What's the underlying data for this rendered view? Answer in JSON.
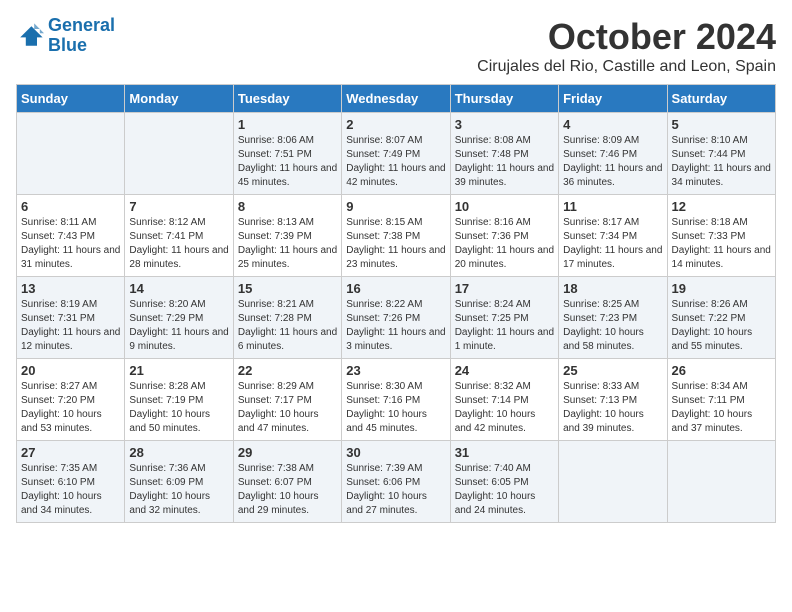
{
  "logo": {
    "line1": "General",
    "line2": "Blue"
  },
  "title": "October 2024",
  "location": "Cirujales del Rio, Castille and Leon, Spain",
  "weekdays": [
    "Sunday",
    "Monday",
    "Tuesday",
    "Wednesday",
    "Thursday",
    "Friday",
    "Saturday"
  ],
  "weeks": [
    [
      {
        "day": "",
        "sunrise": "",
        "sunset": "",
        "daylight": ""
      },
      {
        "day": "",
        "sunrise": "",
        "sunset": "",
        "daylight": ""
      },
      {
        "day": "1",
        "sunrise": "Sunrise: 8:06 AM",
        "sunset": "Sunset: 7:51 PM",
        "daylight": "Daylight: 11 hours and 45 minutes."
      },
      {
        "day": "2",
        "sunrise": "Sunrise: 8:07 AM",
        "sunset": "Sunset: 7:49 PM",
        "daylight": "Daylight: 11 hours and 42 minutes."
      },
      {
        "day": "3",
        "sunrise": "Sunrise: 8:08 AM",
        "sunset": "Sunset: 7:48 PM",
        "daylight": "Daylight: 11 hours and 39 minutes."
      },
      {
        "day": "4",
        "sunrise": "Sunrise: 8:09 AM",
        "sunset": "Sunset: 7:46 PM",
        "daylight": "Daylight: 11 hours and 36 minutes."
      },
      {
        "day": "5",
        "sunrise": "Sunrise: 8:10 AM",
        "sunset": "Sunset: 7:44 PM",
        "daylight": "Daylight: 11 hours and 34 minutes."
      }
    ],
    [
      {
        "day": "6",
        "sunrise": "Sunrise: 8:11 AM",
        "sunset": "Sunset: 7:43 PM",
        "daylight": "Daylight: 11 hours and 31 minutes."
      },
      {
        "day": "7",
        "sunrise": "Sunrise: 8:12 AM",
        "sunset": "Sunset: 7:41 PM",
        "daylight": "Daylight: 11 hours and 28 minutes."
      },
      {
        "day": "8",
        "sunrise": "Sunrise: 8:13 AM",
        "sunset": "Sunset: 7:39 PM",
        "daylight": "Daylight: 11 hours and 25 minutes."
      },
      {
        "day": "9",
        "sunrise": "Sunrise: 8:15 AM",
        "sunset": "Sunset: 7:38 PM",
        "daylight": "Daylight: 11 hours and 23 minutes."
      },
      {
        "day": "10",
        "sunrise": "Sunrise: 8:16 AM",
        "sunset": "Sunset: 7:36 PM",
        "daylight": "Daylight: 11 hours and 20 minutes."
      },
      {
        "day": "11",
        "sunrise": "Sunrise: 8:17 AM",
        "sunset": "Sunset: 7:34 PM",
        "daylight": "Daylight: 11 hours and 17 minutes."
      },
      {
        "day": "12",
        "sunrise": "Sunrise: 8:18 AM",
        "sunset": "Sunset: 7:33 PM",
        "daylight": "Daylight: 11 hours and 14 minutes."
      }
    ],
    [
      {
        "day": "13",
        "sunrise": "Sunrise: 8:19 AM",
        "sunset": "Sunset: 7:31 PM",
        "daylight": "Daylight: 11 hours and 12 minutes."
      },
      {
        "day": "14",
        "sunrise": "Sunrise: 8:20 AM",
        "sunset": "Sunset: 7:29 PM",
        "daylight": "Daylight: 11 hours and 9 minutes."
      },
      {
        "day": "15",
        "sunrise": "Sunrise: 8:21 AM",
        "sunset": "Sunset: 7:28 PM",
        "daylight": "Daylight: 11 hours and 6 minutes."
      },
      {
        "day": "16",
        "sunrise": "Sunrise: 8:22 AM",
        "sunset": "Sunset: 7:26 PM",
        "daylight": "Daylight: 11 hours and 3 minutes."
      },
      {
        "day": "17",
        "sunrise": "Sunrise: 8:24 AM",
        "sunset": "Sunset: 7:25 PM",
        "daylight": "Daylight: 11 hours and 1 minute."
      },
      {
        "day": "18",
        "sunrise": "Sunrise: 8:25 AM",
        "sunset": "Sunset: 7:23 PM",
        "daylight": "Daylight: 10 hours and 58 minutes."
      },
      {
        "day": "19",
        "sunrise": "Sunrise: 8:26 AM",
        "sunset": "Sunset: 7:22 PM",
        "daylight": "Daylight: 10 hours and 55 minutes."
      }
    ],
    [
      {
        "day": "20",
        "sunrise": "Sunrise: 8:27 AM",
        "sunset": "Sunset: 7:20 PM",
        "daylight": "Daylight: 10 hours and 53 minutes."
      },
      {
        "day": "21",
        "sunrise": "Sunrise: 8:28 AM",
        "sunset": "Sunset: 7:19 PM",
        "daylight": "Daylight: 10 hours and 50 minutes."
      },
      {
        "day": "22",
        "sunrise": "Sunrise: 8:29 AM",
        "sunset": "Sunset: 7:17 PM",
        "daylight": "Daylight: 10 hours and 47 minutes."
      },
      {
        "day": "23",
        "sunrise": "Sunrise: 8:30 AM",
        "sunset": "Sunset: 7:16 PM",
        "daylight": "Daylight: 10 hours and 45 minutes."
      },
      {
        "day": "24",
        "sunrise": "Sunrise: 8:32 AM",
        "sunset": "Sunset: 7:14 PM",
        "daylight": "Daylight: 10 hours and 42 minutes."
      },
      {
        "day": "25",
        "sunrise": "Sunrise: 8:33 AM",
        "sunset": "Sunset: 7:13 PM",
        "daylight": "Daylight: 10 hours and 39 minutes."
      },
      {
        "day": "26",
        "sunrise": "Sunrise: 8:34 AM",
        "sunset": "Sunset: 7:11 PM",
        "daylight": "Daylight: 10 hours and 37 minutes."
      }
    ],
    [
      {
        "day": "27",
        "sunrise": "Sunrise: 7:35 AM",
        "sunset": "Sunset: 6:10 PM",
        "daylight": "Daylight: 10 hours and 34 minutes."
      },
      {
        "day": "28",
        "sunrise": "Sunrise: 7:36 AM",
        "sunset": "Sunset: 6:09 PM",
        "daylight": "Daylight: 10 hours and 32 minutes."
      },
      {
        "day": "29",
        "sunrise": "Sunrise: 7:38 AM",
        "sunset": "Sunset: 6:07 PM",
        "daylight": "Daylight: 10 hours and 29 minutes."
      },
      {
        "day": "30",
        "sunrise": "Sunrise: 7:39 AM",
        "sunset": "Sunset: 6:06 PM",
        "daylight": "Daylight: 10 hours and 27 minutes."
      },
      {
        "day": "31",
        "sunrise": "Sunrise: 7:40 AM",
        "sunset": "Sunset: 6:05 PM",
        "daylight": "Daylight: 10 hours and 24 minutes."
      },
      {
        "day": "",
        "sunrise": "",
        "sunset": "",
        "daylight": ""
      },
      {
        "day": "",
        "sunrise": "",
        "sunset": "",
        "daylight": ""
      }
    ]
  ]
}
